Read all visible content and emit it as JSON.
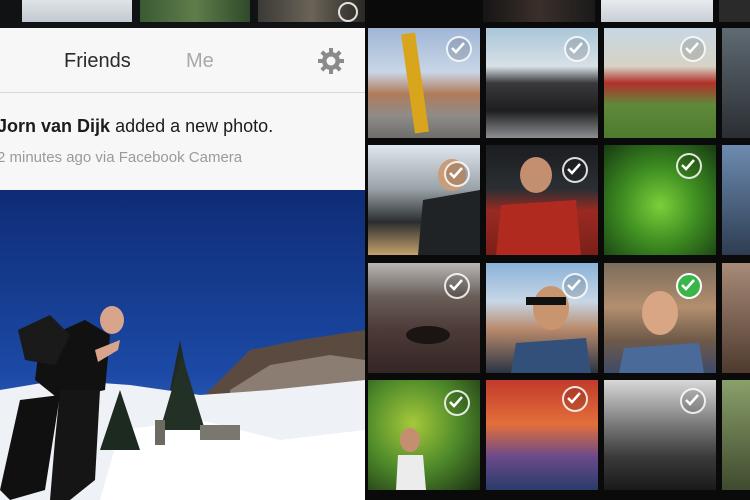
{
  "tabs": {
    "friends": "Friends",
    "me": "Me"
  },
  "story": {
    "author": "Jorn van Dijk",
    "action": "added a new photo.",
    "meta": "2 minutes ago via Facebook Camera"
  },
  "icons": {
    "settings": "gear-icon",
    "selected": "checkmark-icon"
  },
  "colors": {
    "selected_green": "#39b54a",
    "header_bg": "#f7f7f7"
  }
}
